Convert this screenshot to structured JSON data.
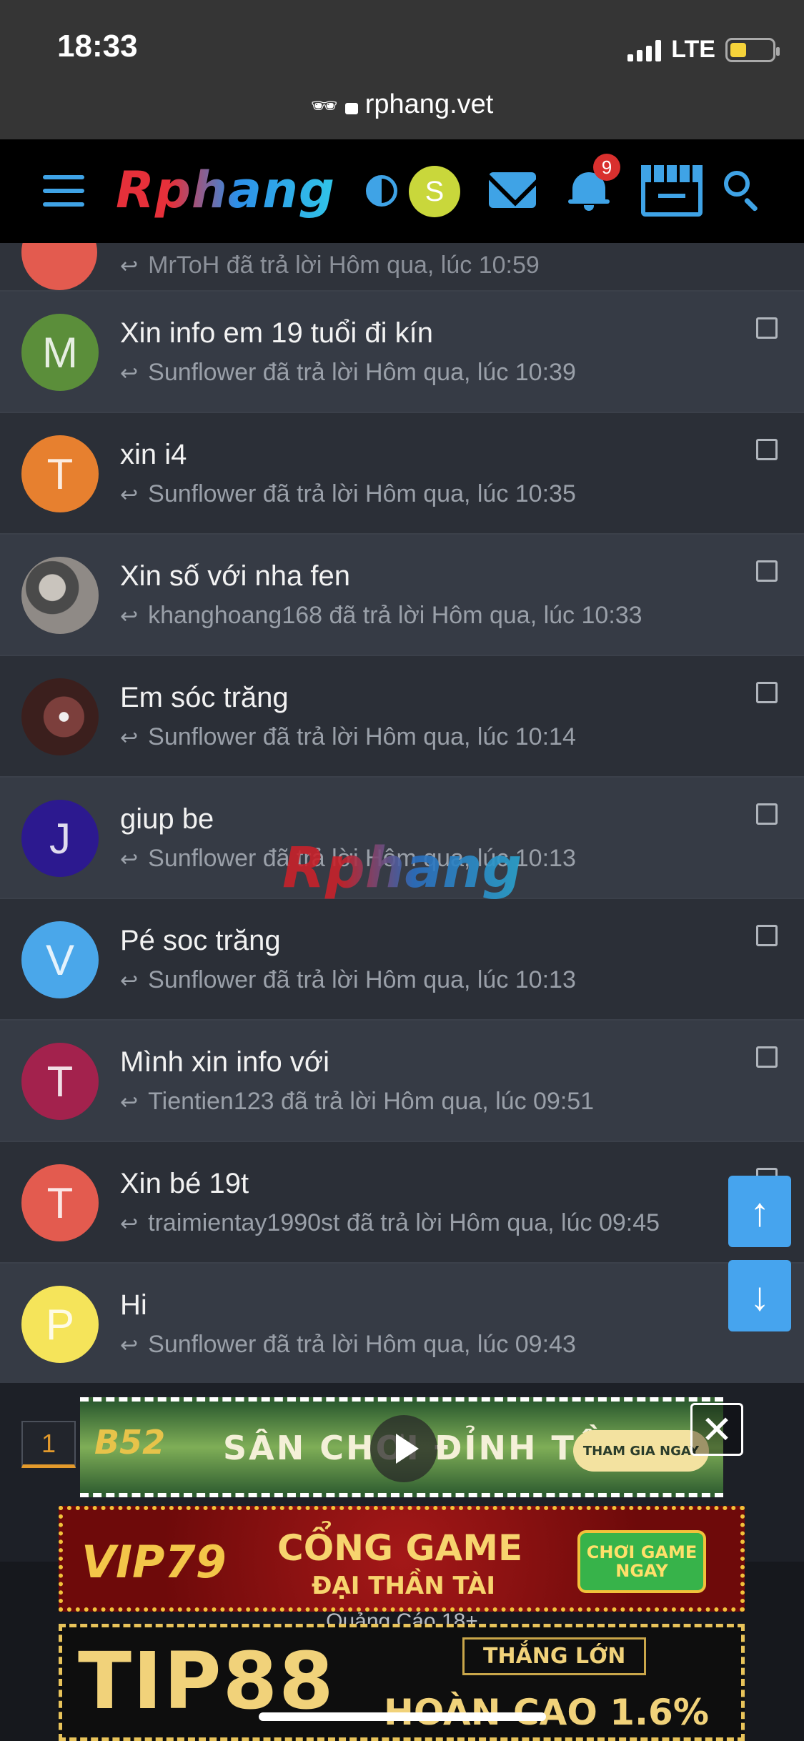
{
  "status": {
    "time": "18:33",
    "network": "LTE",
    "url": "rphang.vet"
  },
  "nav": {
    "logo": "Rphang",
    "avatar_letter": "S",
    "notification_count": "9"
  },
  "partial_item": {
    "meta": "MrToH đã trả lời Hôm qua, lúc 10:59"
  },
  "threads": [
    {
      "title": "Xin info em 19 tuổi đi kín",
      "meta": "Sunflower đã trả lời Hôm qua, lúc 10:39",
      "letter": "M",
      "color": "#5b8e3a"
    },
    {
      "title": "xin i4",
      "meta": "Sunflower đã trả lời Hôm qua, lúc 10:35",
      "letter": "T",
      "color": "#e7802f"
    },
    {
      "title": "Xin số với nha fen",
      "meta": "khanghoang168 đã trả lời Hôm qua, lúc 10:33",
      "letter": "",
      "color": "photo1"
    },
    {
      "title": "Em sóc trăng",
      "meta": "Sunflower đã trả lời Hôm qua, lúc 10:14",
      "letter": "",
      "color": "photo2"
    },
    {
      "title": "giup be",
      "meta": "Sunflower đã trả lời Hôm qua, lúc 10:13",
      "letter": "J",
      "color": "#2c198f"
    },
    {
      "title": "Pé soc trăng",
      "meta": "Sunflower đã trả lời Hôm qua, lúc 10:13",
      "letter": "V",
      "color": "#4aa7ea"
    },
    {
      "title": "Mình xin info với",
      "meta": "Tientien123 đã trả lời Hôm qua, lúc 09:51",
      "letter": "T",
      "color": "#a3224d"
    },
    {
      "title": "Xin bé 19t",
      "meta": "traimientay1990st đã trả lời Hôm qua, lúc 09:45",
      "letter": "T",
      "color": "#e35b4f"
    },
    {
      "title": "Hi",
      "meta": "Sunflower đã trả lời Hôm qua, lúc 09:43",
      "letter": "P",
      "color": "#f5e45a"
    }
  ],
  "watermark": "Rphang",
  "pagination": {
    "current_page": "1"
  },
  "ads": {
    "ad1": {
      "brand": "B52",
      "text": "SÂN CHƠI ĐỈNH TẦN",
      "cta": "THAM GIA NGAY"
    },
    "ad2": {
      "brand": "VIP79",
      "headline": "CỔNG GAME",
      "sub": "ĐẠI THẦN TÀI",
      "cta": "CHƠI GAME NGAY"
    },
    "label": "Quảng Cáo 18+",
    "ad3": {
      "brand": "TIP88",
      "badge": "THẮNG LỚN",
      "promo": "HOÀN CAO 1.6%"
    }
  }
}
